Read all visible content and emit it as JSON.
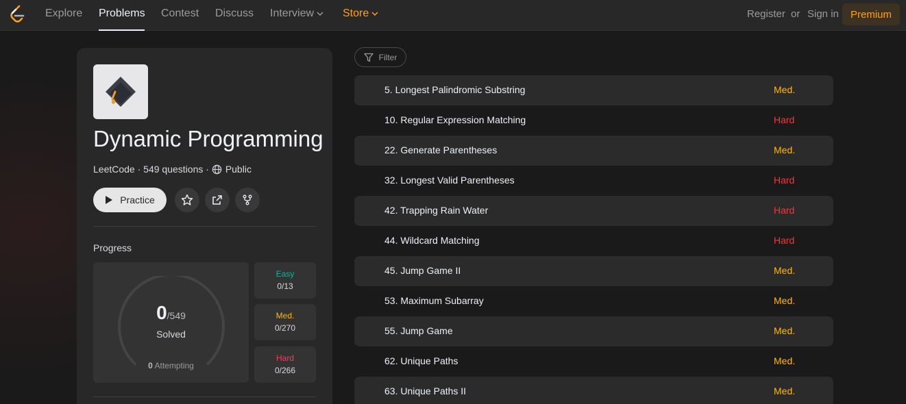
{
  "nav": {
    "items": [
      "Explore",
      "Problems",
      "Contest",
      "Discuss",
      "Interview",
      "Store"
    ],
    "register": "Register",
    "or": "or",
    "sign_in": "Sign in",
    "premium": "Premium"
  },
  "list": {
    "title": "Dynamic Programming",
    "author": "LeetCode",
    "question_count": "549 questions",
    "visibility": "Public",
    "practice_label": "Practice"
  },
  "progress": {
    "label": "Progress",
    "solved": "0",
    "total": "/549",
    "solved_label": "Solved",
    "attempting_count": "0",
    "attempting_label": "Attempting",
    "solved_fraction": 0,
    "easy": {
      "label": "Easy",
      "value": "0/13"
    },
    "medium": {
      "label": "Med.",
      "value": "0/270"
    },
    "hard": {
      "label": "Hard",
      "value": "0/266"
    }
  },
  "filter_label": "Filter",
  "problems": [
    {
      "title": "5. Longest Palindromic Substring",
      "difficulty": "Med."
    },
    {
      "title": "10. Regular Expression Matching",
      "difficulty": "Hard"
    },
    {
      "title": "22. Generate Parentheses",
      "difficulty": "Med."
    },
    {
      "title": "32. Longest Valid Parentheses",
      "difficulty": "Hard"
    },
    {
      "title": "42. Trapping Rain Water",
      "difficulty": "Hard"
    },
    {
      "title": "44. Wildcard Matching",
      "difficulty": "Hard"
    },
    {
      "title": "45. Jump Game II",
      "difficulty": "Med."
    },
    {
      "title": "53. Maximum Subarray",
      "difficulty": "Med."
    },
    {
      "title": "55. Jump Game",
      "difficulty": "Med."
    },
    {
      "title": "62. Unique Paths",
      "difficulty": "Med."
    },
    {
      "title": "63. Unique Paths II",
      "difficulty": "Med."
    }
  ],
  "colors": {
    "accent": "#ffa116",
    "easy": "#00b8a3",
    "medium": "#ffb800",
    "hard": "#f63737"
  }
}
